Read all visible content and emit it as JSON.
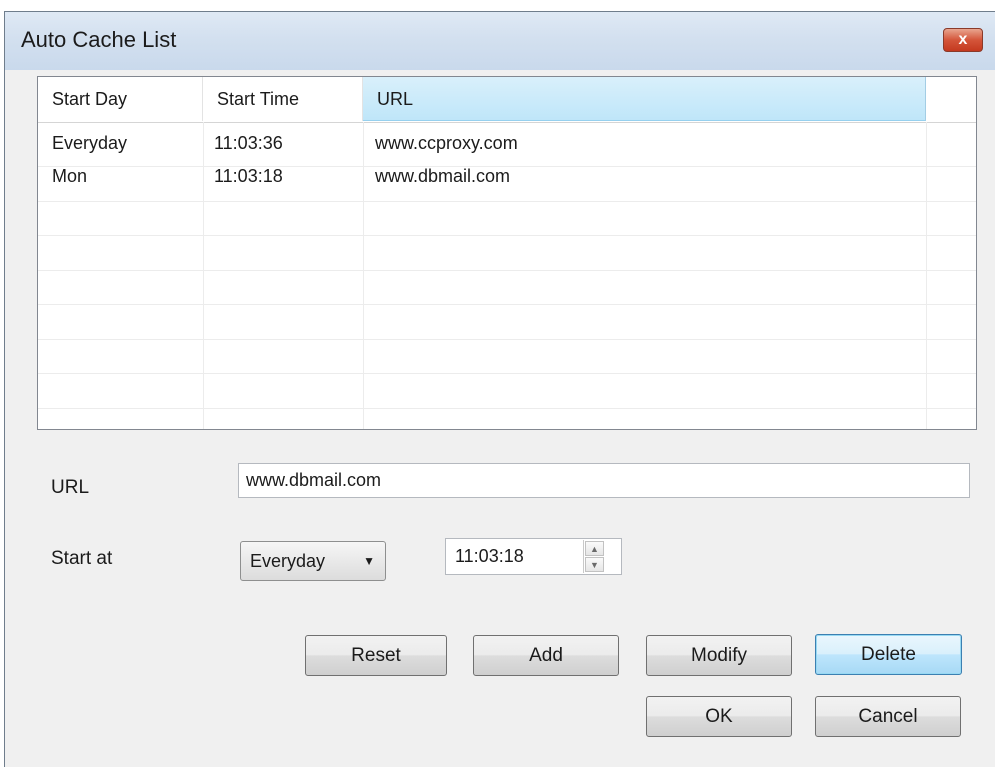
{
  "window": {
    "title": "Auto Cache List",
    "close_label": "x"
  },
  "list": {
    "columns": [
      "Start Day",
      "Start Time",
      "URL"
    ],
    "rows": [
      [
        "Everyday",
        "11:03:36",
        "www.ccproxy.com"
      ],
      [
        "Mon",
        "11:03:18",
        "www.dbmail.com"
      ]
    ]
  },
  "form": {
    "url_label": "URL",
    "url_value": "www.dbmail.com",
    "start_label": "Start at",
    "day_value": "Everyday",
    "time_value": "11:03:18"
  },
  "buttons": {
    "reset": "Reset",
    "add": "Add",
    "modify": "Modify",
    "delete": "Delete",
    "ok": "OK",
    "cancel": "Cancel"
  },
  "icons": {
    "close": "close-icon",
    "dropdown": "chevron-down-icon",
    "spin_up": "arrow-up-icon",
    "spin_down": "arrow-down-icon"
  }
}
